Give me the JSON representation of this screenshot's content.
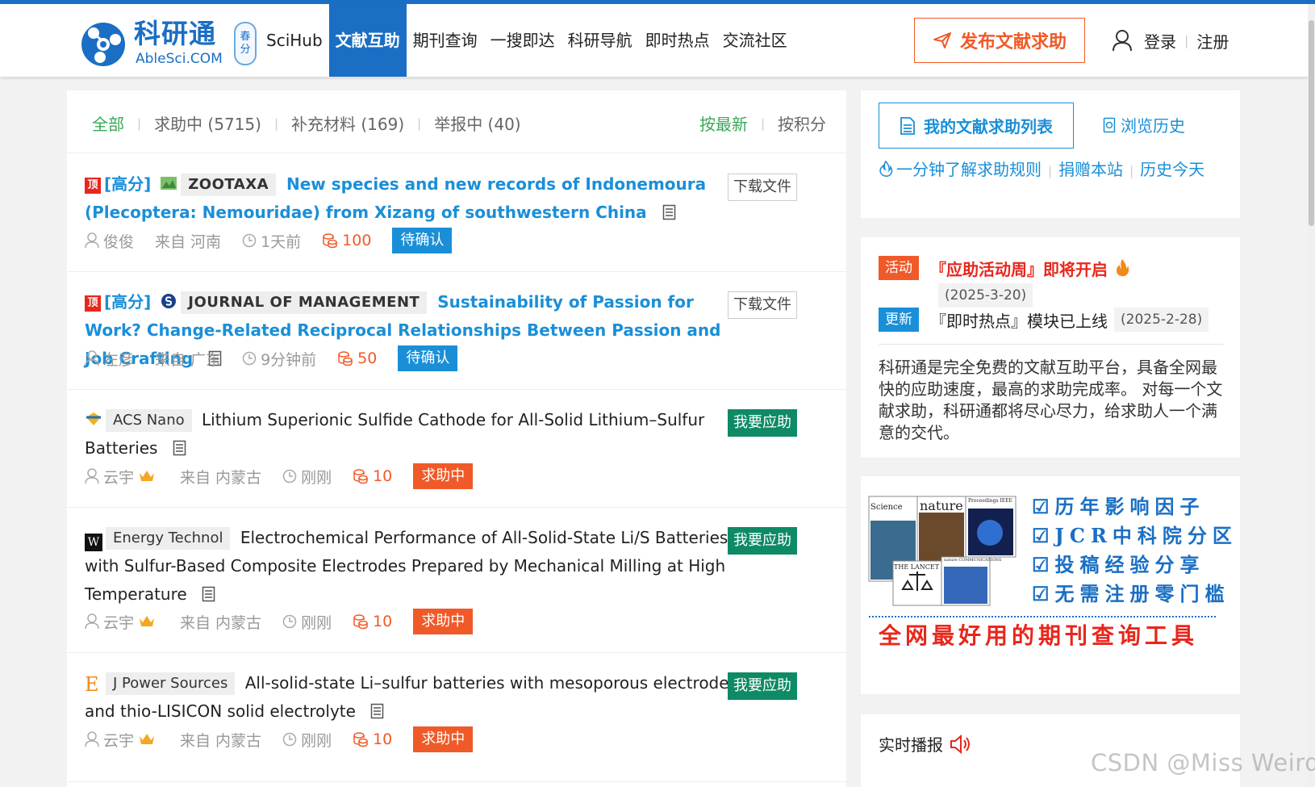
{
  "header": {
    "logo_name": "科研通",
    "logo_sub": "AbleSci.COM",
    "season_top": "春",
    "season_bottom": "分",
    "nav": [
      "SciHub",
      "文献互助",
      "期刊查询",
      "一搜即达",
      "科研导航",
      "即时热点",
      "交流社区"
    ],
    "active_nav": "文献互助",
    "post_button": "发布文献求助",
    "login": "登录",
    "register": "注册"
  },
  "filters": {
    "all": "全部",
    "seeking": "求助中 (5715)",
    "supplement": "补充材料 (169)",
    "reported": "举报中 (40)",
    "sort_latest": "按最新",
    "sort_points": "按积分"
  },
  "items": [
    {
      "top_tag": "顶",
      "hot": "[高分]",
      "journal": "ZOOTAXA",
      "title": "New species and new records of Indonemoura (Plecoptera: Nemouridae) from Xizang of southwestern China",
      "user": "俊俊",
      "region": "来自 河南",
      "time": "1天前",
      "points": "100",
      "status": "待确认",
      "action": "下载文件"
    },
    {
      "top_tag": "顶",
      "hot": "[高分]",
      "journal": "JOURNAL OF MANAGEMENT",
      "title": "Sustainability of Passion for Work? Change-Related Reciprocal Relationships Between Passion and Job Crafting",
      "user": "左彦",
      "region": "来自 广东",
      "time": "9分钟前",
      "points": "50",
      "status": "待确认",
      "action": "下载文件"
    },
    {
      "journal": "ACS Nano",
      "title": "Lithium Superionic Sulfide Cathode for All-Solid Lithium–Sulfur Batteries",
      "user": "云宇",
      "region": "来自 内蒙古",
      "time": "刚刚",
      "points": "10",
      "status": "求助中",
      "action": "我要应助"
    },
    {
      "journal_icon": "W",
      "journal": "Energy Technol",
      "title": "Electrochemical Performance of All-Solid-State Li/S Batteries with Sulfur-Based Composite Electrodes Prepared by Mechanical Milling at High Temperature",
      "user": "云宇",
      "region": "来自 内蒙古",
      "time": "刚刚",
      "points": "10",
      "status": "求助中",
      "action": "我要应助"
    },
    {
      "journal_icon": "E",
      "journal": "J Power Sources",
      "title": "All-solid-state Li–sulfur batteries with mesoporous electrode and thio-LISICON solid electrolyte",
      "user": "云宇",
      "region": "来自 内蒙古",
      "time": "刚刚",
      "points": "10",
      "status": "求助中",
      "action": "我要应助"
    }
  ],
  "sidebar": {
    "my_list": "我的文献求助列表",
    "history": "浏览历史",
    "rules": "一分钟了解求助规则",
    "donate": "捐赠本站",
    "today": "历史今天",
    "news": [
      {
        "tag": "活动",
        "title": "『应助活动周』即将开启",
        "date": "(2025-3-20)"
      },
      {
        "tag": "更新",
        "title": "『即时热点』模块已上线",
        "date": "(2025-2-28)"
      }
    ],
    "about": "科研通是完全免费的文献互助平台，具备全网最快的应助速度，最高的求助完成率。 对每一个文献求助，科研通都将尽心尽力，给求助人一个满意的交代。",
    "ad_lines": [
      "☑历年影响因子",
      "☑JCR中科院分区",
      "☑投稿经验分享",
      "☑无需注册零门槛"
    ],
    "ad_slogan": "全网最好用的期刊查询工具",
    "ad_covers": [
      "Science",
      "nature",
      "Proceedings IEEE",
      "THE LANCET",
      "nature COMMUNICATIONS"
    ],
    "live": "实时播报"
  },
  "watermark": "CSDN @Miss Weird",
  "colors": {
    "brand": "#1a6fc4",
    "link": "#1a8fd8",
    "accent": "#f05a28",
    "green": "#0e8a66"
  }
}
